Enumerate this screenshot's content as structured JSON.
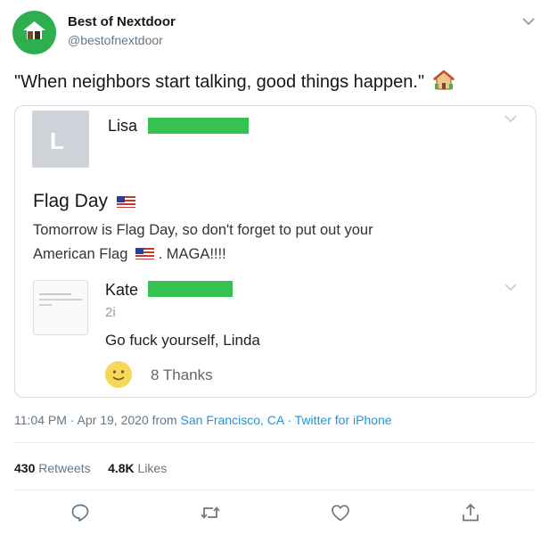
{
  "account": {
    "name": "Best of Nextdoor",
    "handle": "@bestofnextdoor"
  },
  "tweet": {
    "text": "\"When neighbors start talking, good things happen.\""
  },
  "embedded_post": {
    "avatar_letter": "L",
    "author": "Lisa",
    "title": "Flag Day",
    "body_line1": "Tomorrow is Flag Day, so don't forget to put out your",
    "body_line2_a": "American Flag",
    "body_line2_b": ". MAGA!!!!",
    "reply": {
      "author": "Kate",
      "meta": "2i",
      "text": "Go fuck yourself, Linda",
      "thanks": "8 Thanks"
    }
  },
  "meta": {
    "time": "11:04 PM · Apr 19, 2020 from ",
    "location": "San Francisco, CA",
    "separator": " · ",
    "client": "Twitter for iPhone"
  },
  "stats": {
    "retweets_count": "430",
    "retweets_label": "Retweets",
    "likes_count": "4.8K",
    "likes_label": "Likes"
  },
  "colors": {
    "brand_green": "#35c253",
    "link": "#1b95e0",
    "muted": "#657786"
  },
  "icons": [
    "house-icon",
    "chevron-down-icon",
    "us-flag-icon",
    "smile-icon",
    "reply-icon",
    "retweet-icon",
    "like-icon",
    "share-icon"
  ]
}
